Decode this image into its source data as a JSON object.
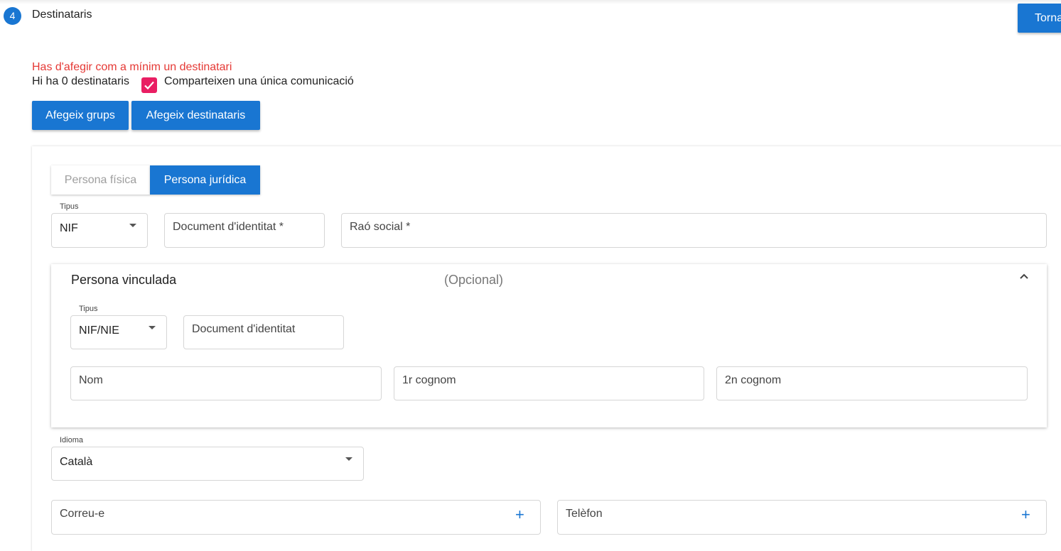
{
  "step": {
    "number": "4",
    "title": "Destinataris"
  },
  "back_button": "Torna",
  "error_message": "Has d'afegir com a mínim un destinatari",
  "recipients_count_text": "Hi ha 0 destinataris",
  "share_checkbox": {
    "label": "Comparteixen una única comunicació",
    "checked": true,
    "color": "#e91e63"
  },
  "buttons": {
    "add_groups": "Afegeix grups",
    "add_recipients": "Afegeix destinataris"
  },
  "tabs": [
    {
      "label": "Persona física",
      "active": false
    },
    {
      "label": "Persona jurídica",
      "active": true
    }
  ],
  "form": {
    "tipus": {
      "label": "Tipus",
      "value": "NIF"
    },
    "document": {
      "placeholder": "Document d'identitat *"
    },
    "raosocial": {
      "placeholder": "Raó social *"
    }
  },
  "linked_person": {
    "title": "Persona vinculada",
    "optional": "(Opcional)",
    "tipus": {
      "label": "Tipus",
      "value": "NIF/NIE"
    },
    "document": {
      "placeholder": "Document d'identitat"
    },
    "nom": {
      "placeholder": "Nom"
    },
    "cognom1": {
      "placeholder": "1r cognom"
    },
    "cognom2": {
      "placeholder": "2n cognom"
    }
  },
  "idioma": {
    "label": "Idioma",
    "value": "Català"
  },
  "email": {
    "placeholder": "Correu-e",
    "add_icon": "+"
  },
  "phone": {
    "placeholder": "Telèfon",
    "add_icon": "+"
  },
  "colors": {
    "primary": "#1976d2",
    "error": "#e53935",
    "checkbox": "#e91e63"
  }
}
